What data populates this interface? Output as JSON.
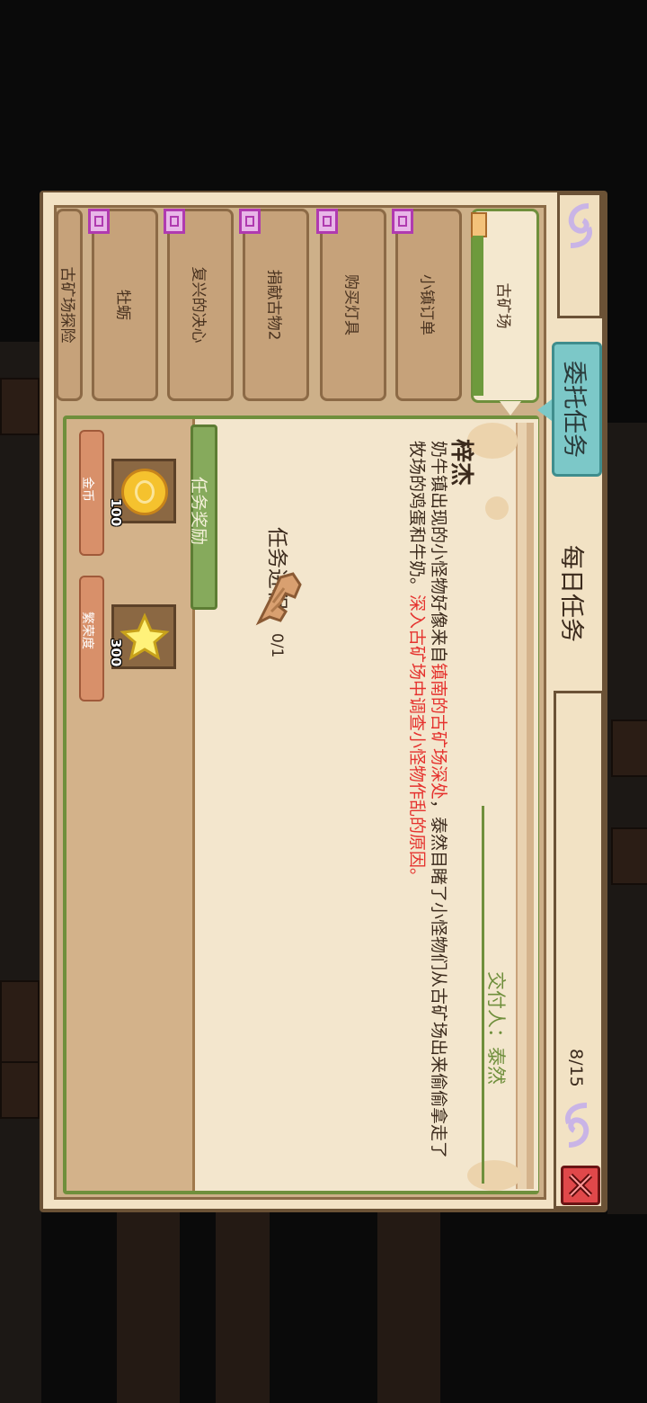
{
  "tabs": {
    "commission": "委托任务",
    "daily": "每日任务",
    "counter": "8/15"
  },
  "quest_list": [
    {
      "label": "古矿场",
      "selected": true
    },
    {
      "label": "小镇订单",
      "selected": false
    },
    {
      "label": "购买灯具",
      "selected": false
    },
    {
      "label": "捐献古物2",
      "selected": false
    },
    {
      "label": "复兴的决心",
      "selected": false
    },
    {
      "label": "牡蛎",
      "selected": false
    },
    {
      "label": "古矿场探险",
      "selected": false
    }
  ],
  "detail": {
    "giver_name": "梓杰",
    "description_normal": "奶牛镇出现的小怪物好像来自",
    "description_red1": "镇南的古矿场深处",
    "description_normal2": "，泰然目睹了小怪物们从古矿场出来偷偷拿走了牧场的鸡蛋和牛奶。",
    "description_red2": "深入古矿场中调查小怪物作乱的原因。",
    "client_label": "交付人：",
    "client_name": "泰然",
    "progress_label": "任务进程：",
    "progress_item_icon": "wing-icon",
    "progress_count": "0/1"
  },
  "rewards": {
    "title": "任务奖励",
    "items": [
      {
        "icon": "gold-coin-icon",
        "count": "100",
        "label": "金币"
      },
      {
        "icon": "star-icon",
        "count": "300",
        "label": "繁荣度"
      }
    ]
  },
  "colors": {
    "accent_green": "#6f8f3c",
    "tab_active": "#7cc8c8",
    "highlight_red": "#e5322e"
  }
}
